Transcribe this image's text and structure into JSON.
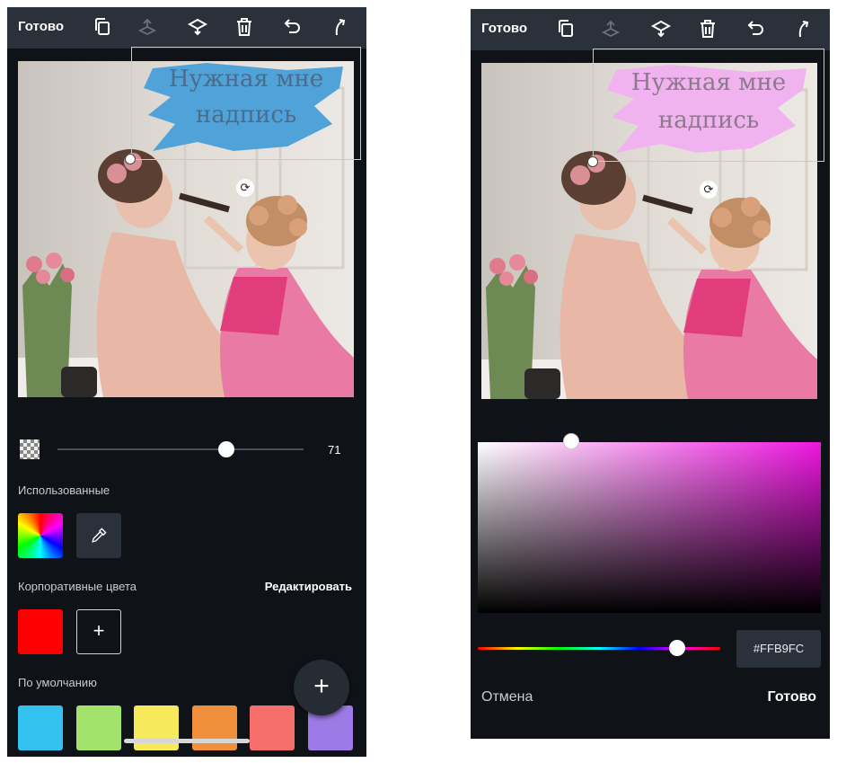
{
  "left": {
    "topbar": {
      "done_label": "Готово"
    },
    "overlay_text": {
      "line1": "Нужная мне",
      "line2": "надпись",
      "brush_color": "#4fa3d8"
    },
    "opacity": {
      "value": "71"
    },
    "section_used": "Использованные",
    "section_brand": "Корпоративные цвета",
    "edit_label": "Редактировать",
    "section_default": "По умолчанию",
    "brand_colors": [
      "#ff0000"
    ],
    "default_colors": [
      "#33c1f0",
      "#a4e36b",
      "#f6e95c",
      "#f0903c",
      "#f56e6a",
      "#9d7be6"
    ],
    "fab_label": "+",
    "add_label": "+"
  },
  "right": {
    "topbar": {
      "done_label": "Готово"
    },
    "overlay_text": {
      "line1": "Нужная мне",
      "line2": "надпись",
      "brush_color": "#f1b3ef"
    },
    "hex_value": "#FFB9FC",
    "picker_hue_color": "#ee16e0",
    "cancel_label": "Отмена",
    "done_label": "Готово"
  },
  "icons": [
    "duplicate-icon",
    "move-back-icon",
    "move-front-icon",
    "delete-icon",
    "undo-icon",
    "redo-icon",
    "checker-icon",
    "eyedropper-icon",
    "rainbow-icon"
  ]
}
